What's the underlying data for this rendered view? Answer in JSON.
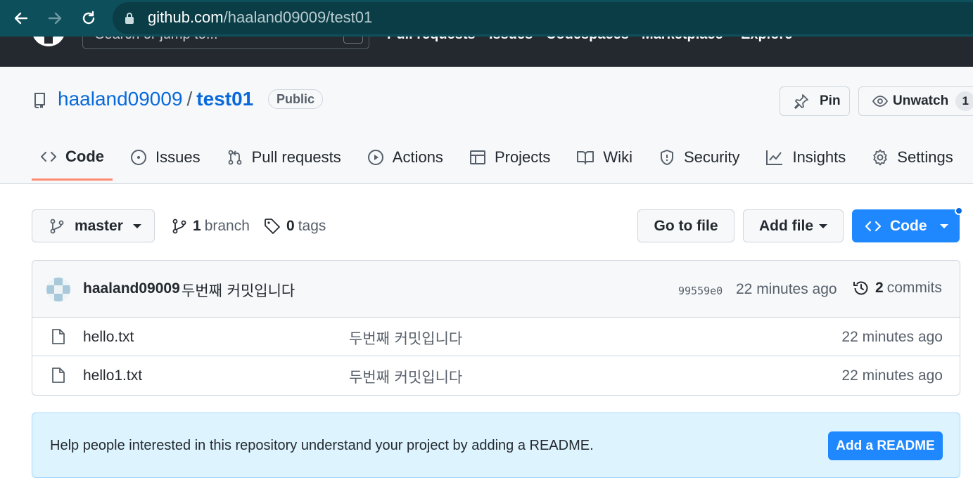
{
  "browser": {
    "url_domain": "github.com",
    "url_path": "/haaland09009/test01"
  },
  "gh_header": {
    "search_placeholder": "Search or jump to...",
    "slash_hint": "/",
    "nav": [
      "Pull requests",
      "Issues",
      "Codespaces",
      "Marketplace",
      "Explore"
    ]
  },
  "repo": {
    "owner": "haaland09009",
    "separator": "/",
    "name": "test01",
    "visibility": "Public",
    "pin_label": "Pin",
    "unwatch_label": "Unwatch",
    "watch_count": "1"
  },
  "tabs": [
    {
      "label": "Code",
      "icon": "code-icon",
      "selected": true
    },
    {
      "label": "Issues",
      "icon": "issue-icon"
    },
    {
      "label": "Pull requests",
      "icon": "pull-request-icon"
    },
    {
      "label": "Actions",
      "icon": "play-icon"
    },
    {
      "label": "Projects",
      "icon": "table-icon"
    },
    {
      "label": "Wiki",
      "icon": "book-icon"
    },
    {
      "label": "Security",
      "icon": "shield-icon"
    },
    {
      "label": "Insights",
      "icon": "graph-icon"
    },
    {
      "label": "Settings",
      "icon": "gear-icon"
    }
  ],
  "actions": {
    "branch_name": "master",
    "branch_count": "1",
    "branch_label": "branch",
    "tag_count": "0",
    "tag_label": "tags",
    "goto_label": "Go to file",
    "addfile_label": "Add file",
    "code_label": "Code"
  },
  "commit": {
    "author": "haaland09009",
    "message": "두번째 커밋입니다",
    "sha": "99559e0",
    "time": "22 minutes ago",
    "count": "2",
    "count_label": "commits"
  },
  "files": [
    {
      "name": "hello.txt",
      "message": "두번째 커밋입니다",
      "time": "22 minutes ago"
    },
    {
      "name": "hello1.txt",
      "message": "두번째 커밋입니다",
      "time": "22 minutes ago"
    }
  ],
  "readme": {
    "text": "Help people interested in this repository understand your project by adding a README.",
    "button": "Add a README"
  },
  "colors": {
    "accent_blue": "#0969da",
    "primary_button": "#1f88ff",
    "tab_underline": "#fd8c73",
    "browser_bar": "#0e4f5c"
  }
}
